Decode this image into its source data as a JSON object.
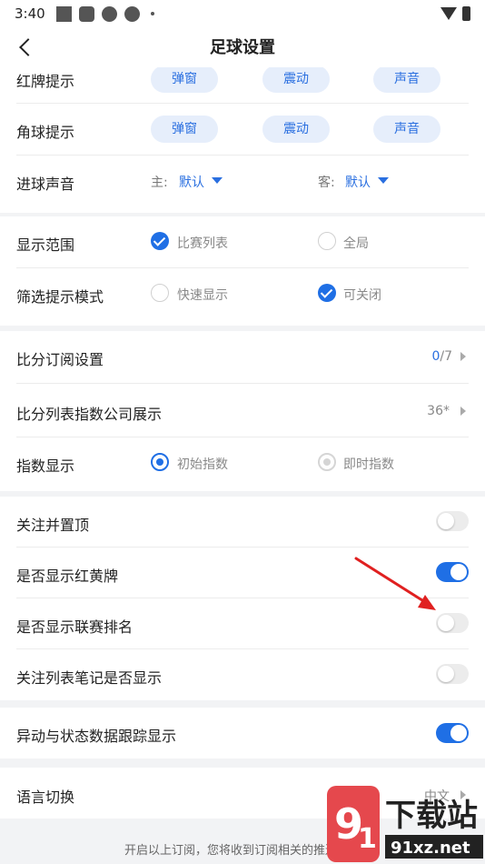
{
  "status_bar": {
    "time": "3:40"
  },
  "nav": {
    "title": "足球设置"
  },
  "alerts": {
    "red_card": {
      "label": "红牌提示",
      "options": [
        "弹窗",
        "震动",
        "声音"
      ]
    },
    "corner": {
      "label": "角球提示",
      "options": [
        "弹窗",
        "震动",
        "声音"
      ]
    },
    "goal_sound": {
      "label": "进球声音",
      "home_prefix": "主:",
      "home_value": "默认",
      "away_prefix": "客:",
      "away_value": "默认"
    }
  },
  "display": {
    "range": {
      "label": "显示范围",
      "options": [
        {
          "text": "比赛列表",
          "checked": true
        },
        {
          "text": "全局",
          "checked": false
        }
      ]
    },
    "filter_mode": {
      "label": "筛选提示模式",
      "options": [
        {
          "text": "快速显示",
          "checked": false
        },
        {
          "text": "可关闭",
          "checked": true
        }
      ]
    }
  },
  "score": {
    "subscription": {
      "label": "比分订阅设置",
      "value_num": "0",
      "value_rest": "/7"
    },
    "index_company": {
      "label": "比分列表指数公司展示",
      "value": "36*"
    },
    "index_display": {
      "label": "指数显示",
      "options": [
        {
          "text": "初始指数",
          "selected": true
        },
        {
          "text": "即时指数",
          "selected": false
        }
      ]
    }
  },
  "toggles": [
    {
      "label": "关注并置顶",
      "on": false
    },
    {
      "label": "是否显示红黄牌",
      "on": true
    },
    {
      "label": "是否显示联赛排名",
      "on": false
    },
    {
      "label": "关注列表笔记是否显示",
      "on": false
    }
  ],
  "tracking": {
    "label": "异动与状态数据跟踪显示",
    "on": true
  },
  "language": {
    "label": "语言切换",
    "value": "中文"
  },
  "footer": {
    "note": "开启以上订阅，您将收到订阅相关的推送消息"
  },
  "watermark": {
    "text": "下载站",
    "url_text": "91xz.net"
  },
  "colors": {
    "accent": "#1f6fe5",
    "pill_bg": "#e6eefb",
    "arrow": "#e02020"
  }
}
